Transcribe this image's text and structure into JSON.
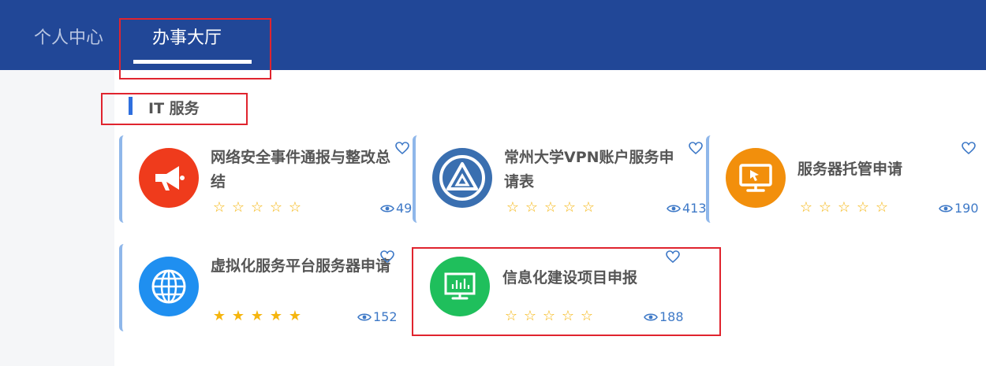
{
  "nav": {
    "personal_label": "个人中心",
    "hall_label": "办事大厅"
  },
  "section": {
    "title": "IT 服务"
  },
  "cards": [
    {
      "title": "网络安全事件通报与整改总结",
      "views": "49",
      "rating": 0,
      "icon": "megaphone-icon",
      "color": "#ef3b1c"
    },
    {
      "title": "常州大学VPN账户服务申请表",
      "views": "413",
      "rating": 0,
      "icon": "triangle-logo-icon",
      "color": "#3a6fb0"
    },
    {
      "title": "服务器托管申请",
      "views": "190",
      "rating": 0,
      "icon": "monitor-cursor-icon",
      "color": "#f28f0c"
    },
    {
      "title": "虚拟化服务平台服务器申请",
      "views": "152",
      "rating": 5,
      "icon": "globe-icon",
      "color": "#1f8ff0"
    },
    {
      "title": "信息化建设项目申报",
      "views": "188",
      "rating": 0,
      "icon": "chart-screen-icon",
      "color": "#1fbf5c"
    }
  ],
  "colors": {
    "header": "#214797",
    "accent": "#2f6fde",
    "star": "#f5b50e",
    "annotation": "#e0242e"
  }
}
